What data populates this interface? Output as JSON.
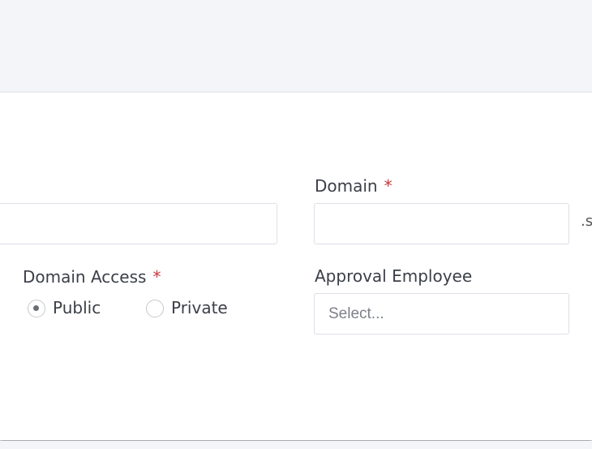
{
  "form": {
    "domain": {
      "label": "Domain",
      "required_mark": "*",
      "value": "",
      "suffix": ".s"
    },
    "left_field": {
      "value": ""
    },
    "domain_access": {
      "label": "Domain Access",
      "required_mark": "*",
      "options": [
        {
          "label": "Public",
          "selected": true
        },
        {
          "label": "Private",
          "selected": false
        }
      ]
    },
    "approval_employee": {
      "label": "Approval Employee",
      "placeholder": "Select..."
    }
  },
  "colors": {
    "background": "#f4f5f8",
    "required": "#c5373e",
    "border": "#dcdfe6"
  }
}
